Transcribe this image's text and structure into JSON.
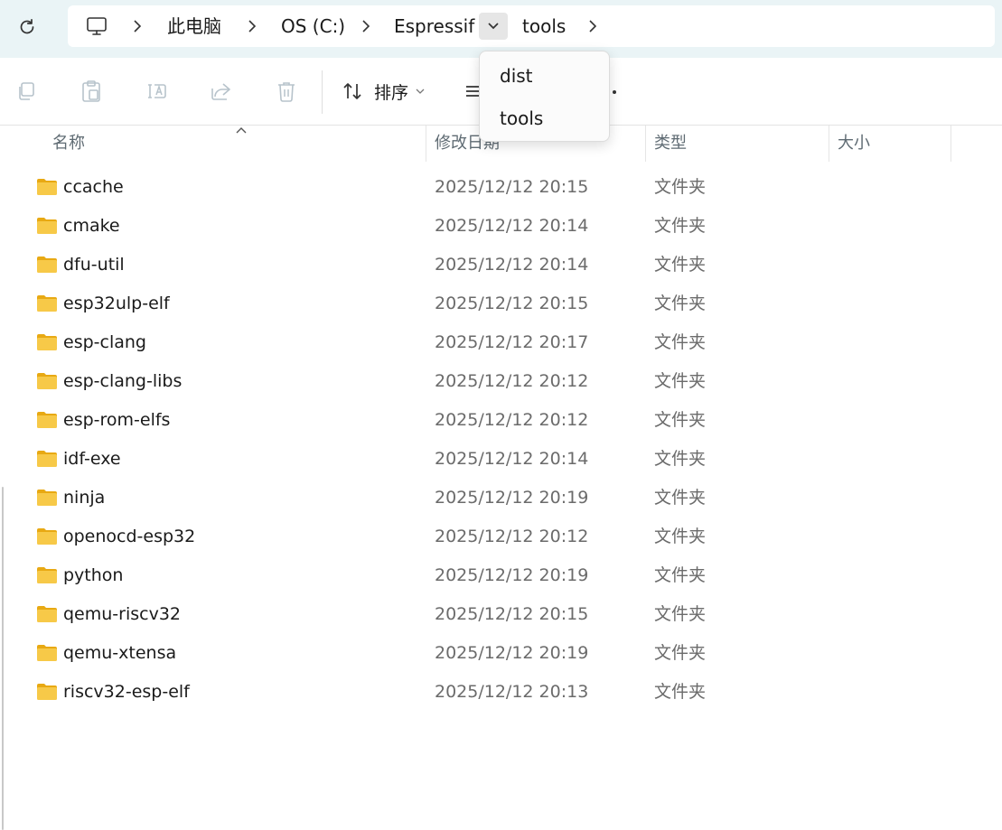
{
  "breadcrumb": {
    "items": [
      "此电脑",
      "OS (C:)",
      "Espressif",
      "tools"
    ]
  },
  "toolbar": {
    "sort_label": "排序"
  },
  "dropdown": {
    "items": [
      "dist",
      "tools"
    ]
  },
  "columns": {
    "name": "名称",
    "date": "修改日期",
    "type": "类型",
    "size": "大小"
  },
  "files": [
    {
      "name": "ccache",
      "date": "2025/12/12 20:15",
      "type": "文件夹"
    },
    {
      "name": "cmake",
      "date": "2025/12/12 20:14",
      "type": "文件夹"
    },
    {
      "name": "dfu-util",
      "date": "2025/12/12 20:14",
      "type": "文件夹"
    },
    {
      "name": "esp32ulp-elf",
      "date": "2025/12/12 20:15",
      "type": "文件夹"
    },
    {
      "name": "esp-clang",
      "date": "2025/12/12 20:17",
      "type": "文件夹"
    },
    {
      "name": "esp-clang-libs",
      "date": "2025/12/12 20:12",
      "type": "文件夹"
    },
    {
      "name": "esp-rom-elfs",
      "date": "2025/12/12 20:12",
      "type": "文件夹"
    },
    {
      "name": "idf-exe",
      "date": "2025/12/12 20:14",
      "type": "文件夹"
    },
    {
      "name": "ninja",
      "date": "2025/12/12 20:19",
      "type": "文件夹"
    },
    {
      "name": "openocd-esp32",
      "date": "2025/12/12 20:12",
      "type": "文件夹"
    },
    {
      "name": "python",
      "date": "2025/12/12 20:19",
      "type": "文件夹"
    },
    {
      "name": "qemu-riscv32",
      "date": "2025/12/12 20:15",
      "type": "文件夹"
    },
    {
      "name": "qemu-xtensa",
      "date": "2025/12/12 20:19",
      "type": "文件夹"
    },
    {
      "name": "riscv32-esp-elf",
      "date": "2025/12/12 20:13",
      "type": "文件夹"
    }
  ],
  "colors": {
    "folder": "#f7c948",
    "folder_back": "#e8a913",
    "addr_strip": "#eaf4f6"
  }
}
